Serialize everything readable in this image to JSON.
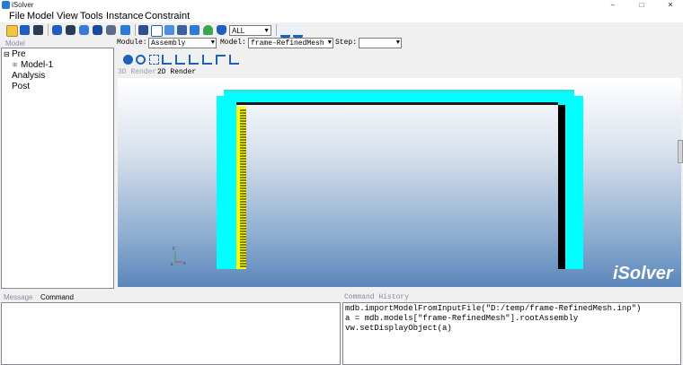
{
  "window": {
    "title": "iSolver",
    "min": "–",
    "max": "□",
    "close": "✕"
  },
  "menu": [
    "File",
    "Model",
    "View",
    "Tools",
    "Instance",
    "Constraint"
  ],
  "toolbar": {
    "display_select": "ALL",
    "icons": [
      "open-icon",
      "save-icon",
      "save-as-icon",
      "cube-blue-icon",
      "cube-dark-icon",
      "cube-shaded-icon",
      "cube-solid-icon",
      "cube-wire-icon",
      "mesh-icon",
      "part-icon",
      "surface-icon",
      "render-icon",
      "select-icon",
      "contour-icon",
      "cylinder-icon",
      "list-icon",
      "select-mode-icon",
      "edit-mode-icon"
    ],
    "colors": {
      "blue": "#1f5fbf",
      "dark": "#2b3a55"
    }
  },
  "module_row": {
    "module_label": "Module:",
    "module_value": "Assembly",
    "model_label": "Model:",
    "model_value": "frame-RefinedMesh",
    "step_label": "Step:",
    "step_value": ""
  },
  "tree": {
    "label": "Model",
    "items": [
      {
        "expander": "⊟",
        "label": "Pre"
      },
      {
        "expander": "⊞",
        "label": "Model-1"
      },
      {
        "expander": "",
        "label": "Analysis"
      },
      {
        "expander": "",
        "label": "Post"
      }
    ]
  },
  "view_tools": [
    "pan-icon",
    "rotate-icon",
    "fit-icon",
    "view-front-icon",
    "view-back-icon",
    "view-left-icon",
    "view-right-icon",
    "view-top-icon",
    "view-iso-icon"
  ],
  "tabs": {
    "tab_3d": "3D Render",
    "tab_2d": "2D Render"
  },
  "viewport": {
    "watermark": "iSolver",
    "colors": {
      "frame": "#00ffff",
      "load": "#ffff00",
      "shadow": "#000000",
      "gradient_bottom": "#5a86bb"
    },
    "axes": {
      "x": "x",
      "y": "y",
      "z": "z"
    }
  },
  "bottom": {
    "message_tab": "Message",
    "command_tab": "Command",
    "history_label": "Command History",
    "history": [
      "mdb.importModelFromInputFile(\"D:/temp/frame-RefinedMesh.inp\")",
      "a = mdb.models[\"frame-RefinedMesh\"].rootAssembly",
      "vw.setDisplayObject(a)"
    ]
  }
}
